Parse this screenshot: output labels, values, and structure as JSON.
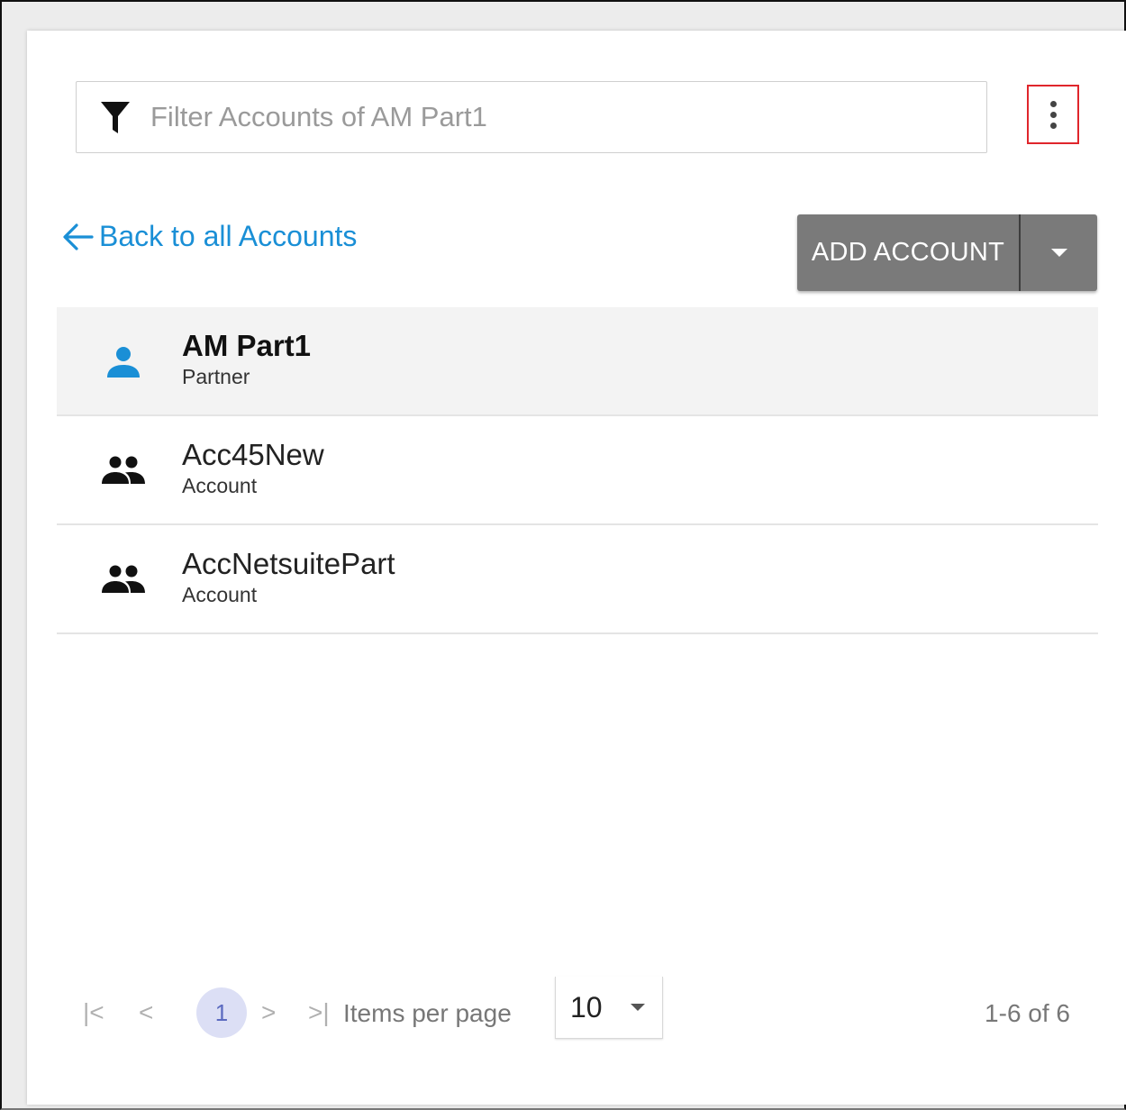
{
  "filter": {
    "placeholder": "Filter Accounts of AM Part1",
    "value": ""
  },
  "header": {
    "back_link": "Back to all Accounts",
    "add_button": "ADD ACCOUNT"
  },
  "accounts": [
    {
      "name": "AM Part1",
      "type": "Partner",
      "icon": "person-icon",
      "selected": true
    },
    {
      "name": "Acc45New",
      "type": "Account",
      "icon": "people-icon",
      "selected": false
    },
    {
      "name": "AccNetsuitePart",
      "type": "Account",
      "icon": "people-icon",
      "selected": false
    }
  ],
  "pagination": {
    "first": "|<",
    "prev": "<",
    "current_page": "1",
    "next": ">",
    "last": ">|",
    "items_per_page_label": "Items per page",
    "items_per_page": "10",
    "range": "1-6 of 6"
  },
  "colors": {
    "accent": "#1a8fd6",
    "add_button_bg": "#7a7a7a",
    "kebab_outline": "#e0262c",
    "current_page_bg": "#dcdff5"
  }
}
